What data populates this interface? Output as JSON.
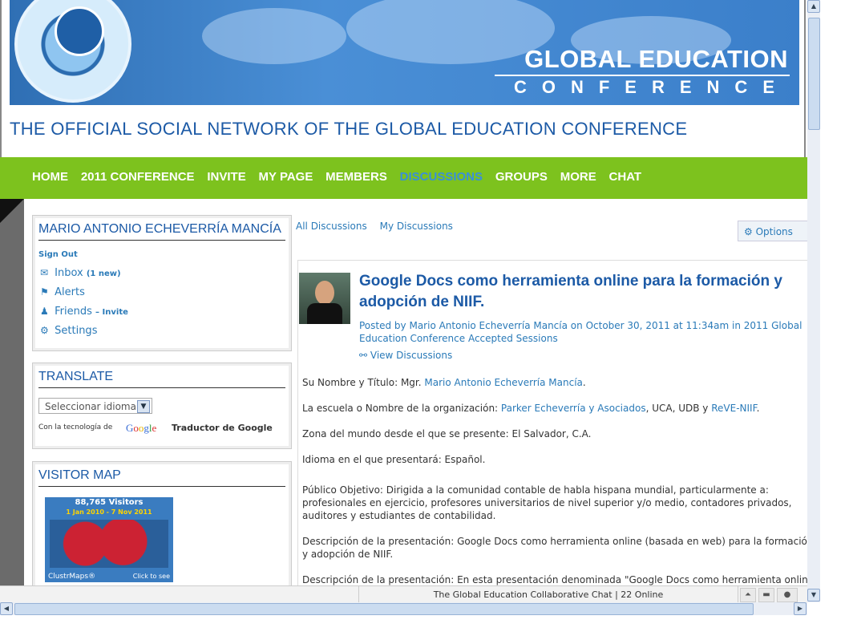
{
  "header": {
    "banner_title": "GLOBAL EDUCATION",
    "banner_subtitle": "CONFERENCE",
    "tagline": "THE OFFICIAL SOCIAL NETWORK OF THE GLOBAL EDUCATION CONFERENCE"
  },
  "nav": {
    "items": [
      "HOME",
      "2011 CONFERENCE",
      "INVITE",
      "MY PAGE",
      "MEMBERS",
      "DISCUSSIONS",
      "GROUPS",
      "MORE",
      "CHAT"
    ],
    "active": "DISCUSSIONS"
  },
  "user_module": {
    "name": "MARIO ANTONIO ECHEVERRÍA MANCÍA",
    "sign_out": "Sign Out",
    "inbox": "Inbox",
    "inbox_count": "(1 new)",
    "alerts": "Alerts",
    "friends": "Friends",
    "friends_invite": "– Invite",
    "settings": "Settings"
  },
  "translate_module": {
    "title": "TRANSLATE",
    "select_value": "Seleccionar idioma",
    "powered_by": "Con la tecnología de",
    "google": "Google",
    "translator": "Traductor de Google"
  },
  "map_module": {
    "title": "VISITOR MAP",
    "visitors": "88,765 Visitors",
    "dates": "1 Jan 2010 - 7 Nov 2011",
    "brand": "ClustrMaps®",
    "click": "Click to see"
  },
  "tabs": {
    "all": "All Discussions",
    "mine": "My Discussions",
    "options": "Options"
  },
  "post": {
    "title": "Google Docs como herramienta online para la formación y adopción de NIIF.",
    "meta_prefix": "Posted by",
    "author": "Mario Antonio Echeverría Mancía",
    "meta_on": "on",
    "date": "October 30, 2011 at 11:34am",
    "meta_in": "in",
    "category": "2011 Global Education Conference Accepted Sessions",
    "view_discussions": "View Discussions",
    "p1_label": "Su Nombre y Título: Mgr.",
    "p1_link": "Mario Antonio Echeverría Mancía",
    "p2_label": "La escuela o Nombre de la organización:",
    "p2_link1": "Parker Echeverría y Asociados",
    "p2_mid": ", UCA, UDB y",
    "p2_link2": "ReVE-NIIF",
    "p3": "Zona del mundo desde el que se presente: El Salvador, C.A.",
    "p4": "Idioma en el que presentará: Español.",
    "p5": "Público Objetivo: Dirigida a la comunidad contable de habla hispana mundial, particularmente a: profesionales en ejercicio, profesores universitarios de nivel superior y/o medio, contadores privados, auditores y estudiantes de contabilidad.",
    "p6": "Descripción de la presentación: Google Docs como herramienta online (basada en web) para la formación y adopción de NIIF.",
    "p7": "Descripción de la presentación: En esta presentación denominada \"Google Docs como herramienta online"
  },
  "status": {
    "chat": "The Global Education Collaborative Chat | 22 Online"
  }
}
